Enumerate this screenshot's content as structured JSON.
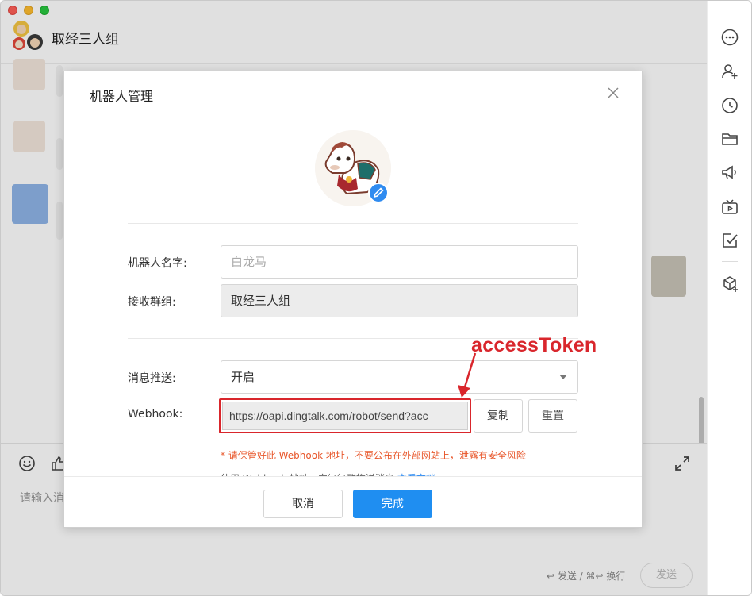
{
  "window": {
    "chat_title": "取经三人组"
  },
  "input": {
    "placeholder": "请输入消",
    "send_hint": "↩ 发送 / ⌘↩ 换行",
    "send_label": "发送"
  },
  "rail": {
    "icons": [
      "more-icon",
      "add-member-icon",
      "history-icon",
      "folder-icon",
      "announcement-icon",
      "live-icon",
      "task-icon",
      "app-add-icon"
    ]
  },
  "dialog": {
    "title": "机器人管理",
    "name_label": "机器人名字:",
    "name_placeholder": "白龙马",
    "group_label": "接收群组:",
    "group_value": "取经三人组",
    "push_label": "消息推送:",
    "push_value": "开启",
    "webhook_label": "Webhook:",
    "webhook_value": "https://oapi.dingtalk.com/robot/send?acc",
    "copy_label": "复制",
    "reset_label": "重置",
    "warning": "* 请保管好此 Webhook 地址，不要公布在外部网站上，泄露有安全风险",
    "usage_text": "使用 Webhook 地址，向钉钉群推送消息",
    "usage_link": "查看文档",
    "cancel_label": "取消",
    "done_label": "完成"
  },
  "annotation": {
    "text": "accessToken",
    "color": "#d9262c"
  },
  "colors": {
    "primary": "#1f8ef1",
    "highlight": "#d9262c",
    "warning": "#e8562a"
  }
}
